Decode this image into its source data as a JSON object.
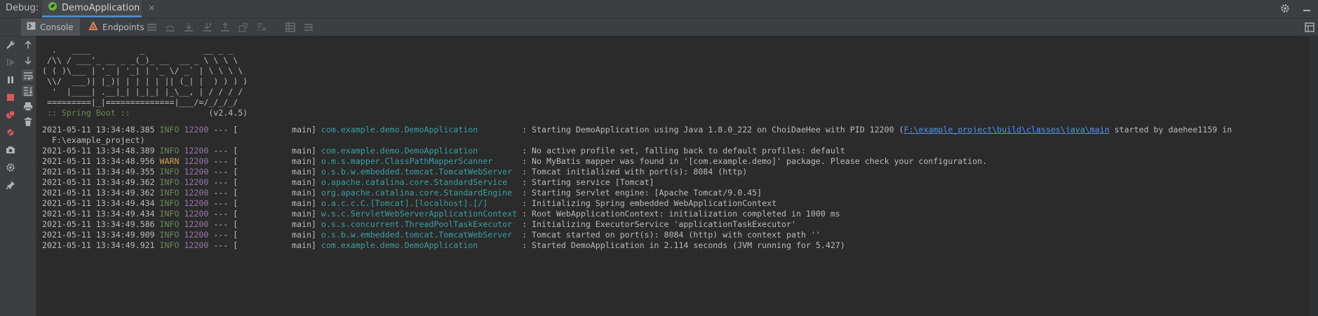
{
  "titlebar": {
    "label": "Debug:",
    "tab_title": "DemoApplication",
    "tab_close": "×"
  },
  "toolbar": {
    "console_tab": "Console",
    "endpoints_tab": "Endpoints"
  },
  "colors": {
    "background": "#2b2b2b",
    "panel": "#3c3f41",
    "info": "#6a8759",
    "warn": "#d29f4f",
    "pid": "#9876aa",
    "logger": "#3a9fa3",
    "link": "#5394ec"
  },
  "icons": {
    "titlebar": [
      "gear-icon",
      "minimize-icon"
    ],
    "toolbar": [
      "menu-icon",
      "step-over-icon",
      "step-into-icon",
      "force-step-into-icon",
      "step-out-icon",
      "drop-frame-icon",
      "run-to-cursor-icon",
      "table-icon",
      "evaluate-icon",
      "layout-icon"
    ],
    "left": [
      "rerun-icon",
      "wrench-icon",
      "resume-icon",
      "pause-icon",
      "stop-icon",
      "breakpoints-icon",
      "mute-breakpoints-icon",
      "camera-icon",
      "settings-icon",
      "pin-icon"
    ],
    "console_side": [
      "up-arrow-icon",
      "down-arrow-icon",
      "soft-wrap-icon",
      "scroll-to-end-icon",
      "print-icon",
      "trash-icon"
    ]
  },
  "banner": {
    "lines": [
      "  .   ____          _            __ _ _",
      " /\\\\ / ___'_ __ _ _(_)_ __  __ _ \\ \\ \\ \\",
      "( ( )\\___ | '_ | '_| | '_ \\/ _` | \\ \\ \\ \\",
      " \\\\/  ___)| |_)| | | | | || (_| |  ) ) ) )",
      "  '  |____| .__|_| |_|_| |_\\__, | / / / /",
      " =========|_|==============|___/=/_/_/_/"
    ],
    "spring_label": " :: Spring Boot ::",
    "version": "                (v2.4.5)"
  },
  "logs": [
    {
      "time": "2021-05-11 13:34:48.385",
      "level": "INFO",
      "pid": "12200",
      "sep": " --- [",
      "thread": "           main] ",
      "logger": "com.example.demo.DemoApplication        ",
      "pre": " : Starting DemoApplication using Java 1.8.0_222 on ChoiDaeHee with PID 12200 (",
      "link": "F:\\example_project\\build\\classes\\java\\main",
      "post": " started by daehee1159 in"
    },
    {
      "continuation": "  F:\\example_project)"
    },
    {
      "time": "2021-05-11 13:34:48.389",
      "level": "INFO",
      "pid": "12200",
      "sep": " --- [",
      "thread": "           main] ",
      "logger": "com.example.demo.DemoApplication        ",
      "pre": " : No active profile set, falling back to default profiles: default"
    },
    {
      "time": "2021-05-11 13:34:48.956",
      "level": "WARN",
      "pid": "12200",
      "sep": " --- [",
      "thread": "           main] ",
      "logger": "o.m.s.mapper.ClassPathMapperScanner     ",
      "pre": " : No MyBatis mapper was found in '[com.example.demo]' package. Please check your configuration."
    },
    {
      "time": "2021-05-11 13:34:49.355",
      "level": "INFO",
      "pid": "12200",
      "sep": " --- [",
      "thread": "           main] ",
      "logger": "o.s.b.w.embedded.tomcat.TomcatWebServer ",
      "pre": " : Tomcat initialized with port(s): 8084 (http)"
    },
    {
      "time": "2021-05-11 13:34:49.362",
      "level": "INFO",
      "pid": "12200",
      "sep": " --- [",
      "thread": "           main] ",
      "logger": "o.apache.catalina.core.StandardService  ",
      "pre": " : Starting service [Tomcat]"
    },
    {
      "time": "2021-05-11 13:34:49.362",
      "level": "INFO",
      "pid": "12200",
      "sep": " --- [",
      "thread": "           main] ",
      "logger": "org.apache.catalina.core.StandardEngine ",
      "pre": " : Starting Servlet engine: [Apache Tomcat/9.0.45]"
    },
    {
      "time": "2021-05-11 13:34:49.434",
      "level": "INFO",
      "pid": "12200",
      "sep": " --- [",
      "thread": "           main] ",
      "logger": "o.a.c.c.C.[Tomcat].[localhost].[/]      ",
      "pre": " : Initializing Spring embedded WebApplicationContext"
    },
    {
      "time": "2021-05-11 13:34:49.434",
      "level": "INFO",
      "pid": "12200",
      "sep": " --- [",
      "thread": "           main] ",
      "logger": "w.s.c.ServletWebServerApplicationContext",
      "pre": " : Root WebApplicationContext: initialization completed in 1000 ms"
    },
    {
      "time": "2021-05-11 13:34:49.586",
      "level": "INFO",
      "pid": "12200",
      "sep": " --- [",
      "thread": "           main] ",
      "logger": "o.s.s.concurrent.ThreadPoolTaskExecutor ",
      "pre": " : Initializing ExecutorService 'applicationTaskExecutor'"
    },
    {
      "time": "2021-05-11 13:34:49.909",
      "level": "INFO",
      "pid": "12200",
      "sep": " --- [",
      "thread": "           main] ",
      "logger": "o.s.b.w.embedded.tomcat.TomcatWebServer ",
      "pre": " : Tomcat started on port(s): 8084 (http) with context path ''"
    },
    {
      "time": "2021-05-11 13:34:49.921",
      "level": "INFO",
      "pid": "12200",
      "sep": " --- [",
      "thread": "           main] ",
      "logger": "com.example.demo.DemoApplication        ",
      "pre": " : Started DemoApplication in 2.114 seconds (JVM running for 5.427)"
    }
  ]
}
